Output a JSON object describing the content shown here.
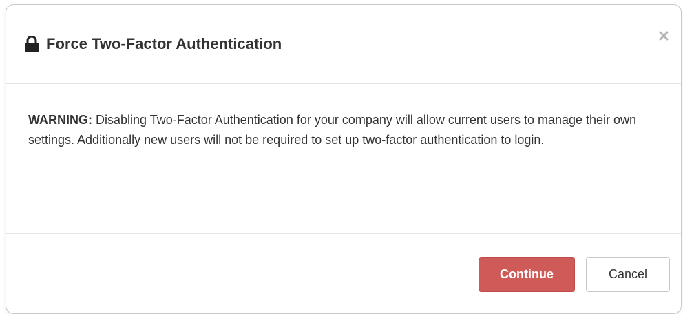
{
  "dialog": {
    "title": "Force Two-Factor Authentication",
    "close_label": "×",
    "warning_label": "WARNING:",
    "warning_message": " Disabling Two-Factor Authentication for your company will allow current users to manage their own settings. Additionally new users will not be required to set up two-factor authentication to login.",
    "continue_label": "Continue",
    "cancel_label": "Cancel"
  },
  "icons": {
    "title_icon": "lock-icon",
    "close_icon": "close-icon"
  },
  "colors": {
    "danger": "#cf5b58",
    "text": "#333333",
    "border": "#e5e5e5"
  }
}
